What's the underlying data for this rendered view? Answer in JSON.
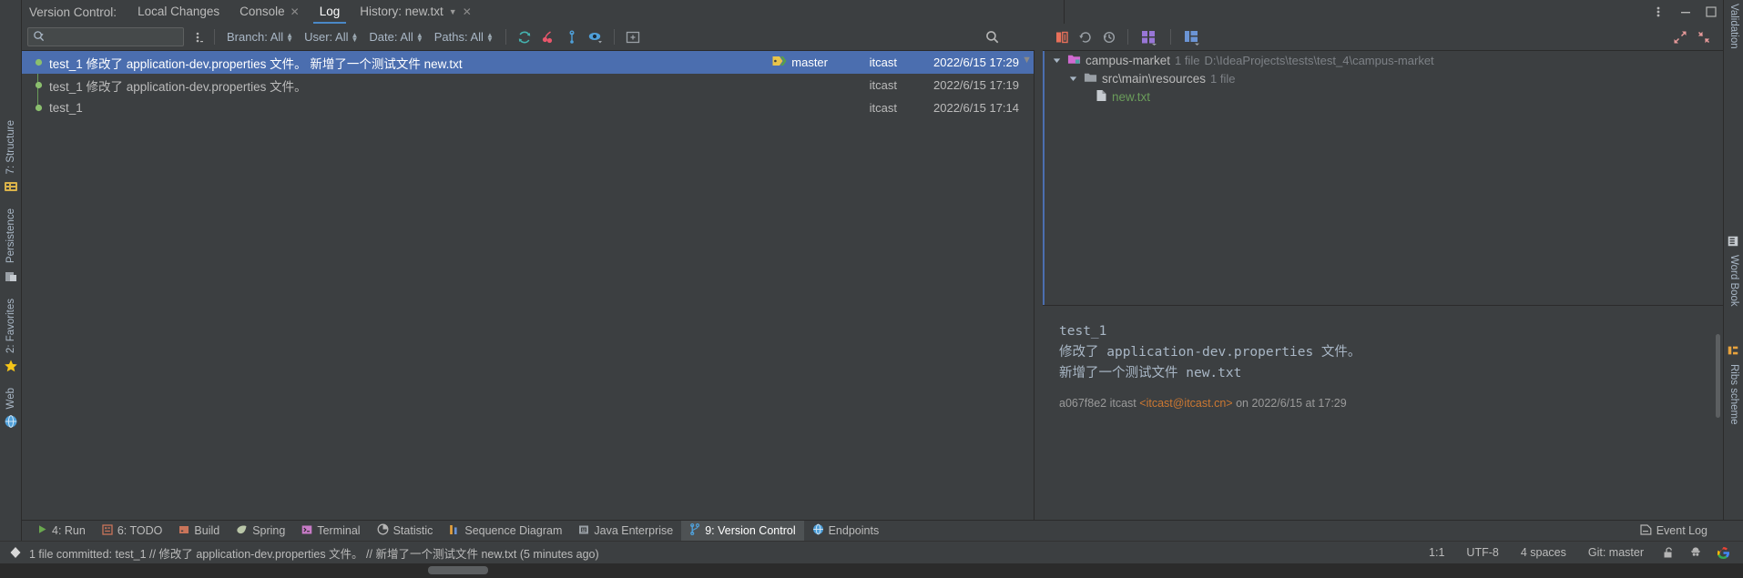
{
  "window": {
    "title": "Version Control:",
    "minimize_label": "—",
    "maximize_label": "▭",
    "more_label": "⋮"
  },
  "tabs": [
    {
      "label": "Local Changes",
      "active": false,
      "closable": false
    },
    {
      "label": "Console",
      "active": false,
      "closable": true
    },
    {
      "label": "Log",
      "active": true,
      "closable": false
    },
    {
      "label": "History: new.txt",
      "active": false,
      "closable": true,
      "has_caret": true
    }
  ],
  "toolbar": {
    "search_placeholder": "",
    "search_value": "",
    "search_icon": "search-icon",
    "kebab_icon": "more-options-icon",
    "filters": [
      {
        "name": "branch-filter",
        "label": "Branch: All"
      },
      {
        "name": "user-filter",
        "label": "User: All"
      },
      {
        "name": "date-filter",
        "label": "Date: All"
      },
      {
        "name": "paths-filter",
        "label": "Paths: All"
      }
    ],
    "icons": [
      {
        "name": "refresh-icon",
        "color": "#45b3b0"
      },
      {
        "name": "cherry-pick-icon",
        "color": "#e8566b"
      },
      {
        "name": "branch-icon",
        "color": "#4f9fd8"
      },
      {
        "name": "show-details-eye-icon",
        "color": "#4f9fd8"
      },
      {
        "name": "expand-box-icon",
        "color": "#9aa0a6"
      }
    ]
  },
  "right_toolbar": {
    "icons": [
      {
        "name": "diff-icon",
        "color": "#e8705a"
      },
      {
        "name": "revert-icon",
        "color": "#9aa0a6"
      },
      {
        "name": "history-icon",
        "color": "#9aa0a6"
      },
      {
        "name": "group-by-icon",
        "color": "#9876d6"
      },
      {
        "name": "preview-layout-icon",
        "color": "#6b94d4"
      },
      {
        "name": "expand-all-icon",
        "color": "#e89a9a"
      },
      {
        "name": "collapse-all-icon",
        "color": "#e89a9a"
      }
    ]
  },
  "commits": {
    "columns": [
      "message",
      "tag",
      "author",
      "date"
    ],
    "rows": [
      {
        "message": "test_1 修改了 application-dev.properties 文件。 新增了一个测试文件 new.txt",
        "tag": "master",
        "author": "itcast",
        "date": "2022/6/15 17:29",
        "selected": true
      },
      {
        "message": "test_1 修改了 application-dev.properties 文件。",
        "tag": "",
        "author": "itcast",
        "date": "2022/6/15 17:19",
        "selected": false
      },
      {
        "message": "test_1",
        "tag": "",
        "author": "itcast",
        "date": "2022/6/15 17:14",
        "selected": false
      }
    ]
  },
  "changed_files": {
    "root": {
      "label": "campus-market",
      "count": "1 file",
      "path": "D:\\IdeaProjects\\tests\\test_4\\campus-market"
    },
    "folder": {
      "label": "src\\main\\resources",
      "count": "1 file"
    },
    "file": {
      "label": "new.txt"
    }
  },
  "commit_detail": {
    "message": "test_1\n修改了 application-dev.properties 文件。\n新增了一个测试文件 new.txt",
    "hash": "a067f8e2",
    "author": "itcast",
    "email": "<itcast@itcast.cn>",
    "meta_prefix": "a067f8e2 itcast ",
    "meta_suffix": " on 2022/6/15 at 17:29"
  },
  "left_rail": [
    {
      "label": "7: Structure",
      "icon": "structure-icon"
    },
    {
      "label": "Persistence",
      "icon": "persistence-icon"
    },
    {
      "label": "2: Favorites",
      "icon": "star-icon"
    },
    {
      "label": "Web",
      "icon": "web-icon"
    }
  ],
  "right_rail": [
    {
      "label": "Validation",
      "icon": "validation-icon"
    },
    {
      "label": "Word Book",
      "icon": "wordbook-icon"
    },
    {
      "label": "Ribs scheme",
      "icon": "ribs-icon"
    }
  ],
  "bottom_bar": [
    {
      "label": "4: Run",
      "underline": "4",
      "icon": "run-icon",
      "active": false
    },
    {
      "label": "6: TODO",
      "underline": "6",
      "icon": "todo-icon",
      "active": false
    },
    {
      "label": "Build",
      "underline": "",
      "icon": "build-icon",
      "active": false
    },
    {
      "label": "Spring",
      "underline": "",
      "icon": "spring-icon",
      "active": false
    },
    {
      "label": "Terminal",
      "underline": "",
      "icon": "terminal-icon",
      "active": false
    },
    {
      "label": "Statistic",
      "underline": "",
      "icon": "statistic-icon",
      "active": false
    },
    {
      "label": "Sequence Diagram",
      "underline": "",
      "icon": "sequence-diagram-icon",
      "active": false
    },
    {
      "label": "Java Enterprise",
      "underline": "",
      "icon": "java-enterprise-icon",
      "active": false
    },
    {
      "label": "9: Version Control",
      "underline": "9",
      "icon": "version-control-icon",
      "active": true
    },
    {
      "label": "Endpoints",
      "underline": "",
      "icon": "endpoints-icon",
      "active": false
    }
  ],
  "event_log": {
    "label": "Event Log",
    "icon": "event-log-icon"
  },
  "status_bar": {
    "message": "1 file committed: test_1 // 修改了 application-dev.properties 文件。 // 新增了一个测试文件 new.txt (5 minutes ago)",
    "caret": "1:1",
    "encoding": "UTF-8",
    "indent": "4 spaces",
    "branch": "Git: master",
    "icons": [
      "lock-icon",
      "hacker-icon",
      "google-icon"
    ]
  },
  "colors": {
    "background": "#3c3f41",
    "selection": "#4b6eaf",
    "accent": "#4a88c7",
    "graph_green": "#6a9c5a",
    "file_green": "#6a9c5a",
    "email_orange": "#cc7832"
  }
}
